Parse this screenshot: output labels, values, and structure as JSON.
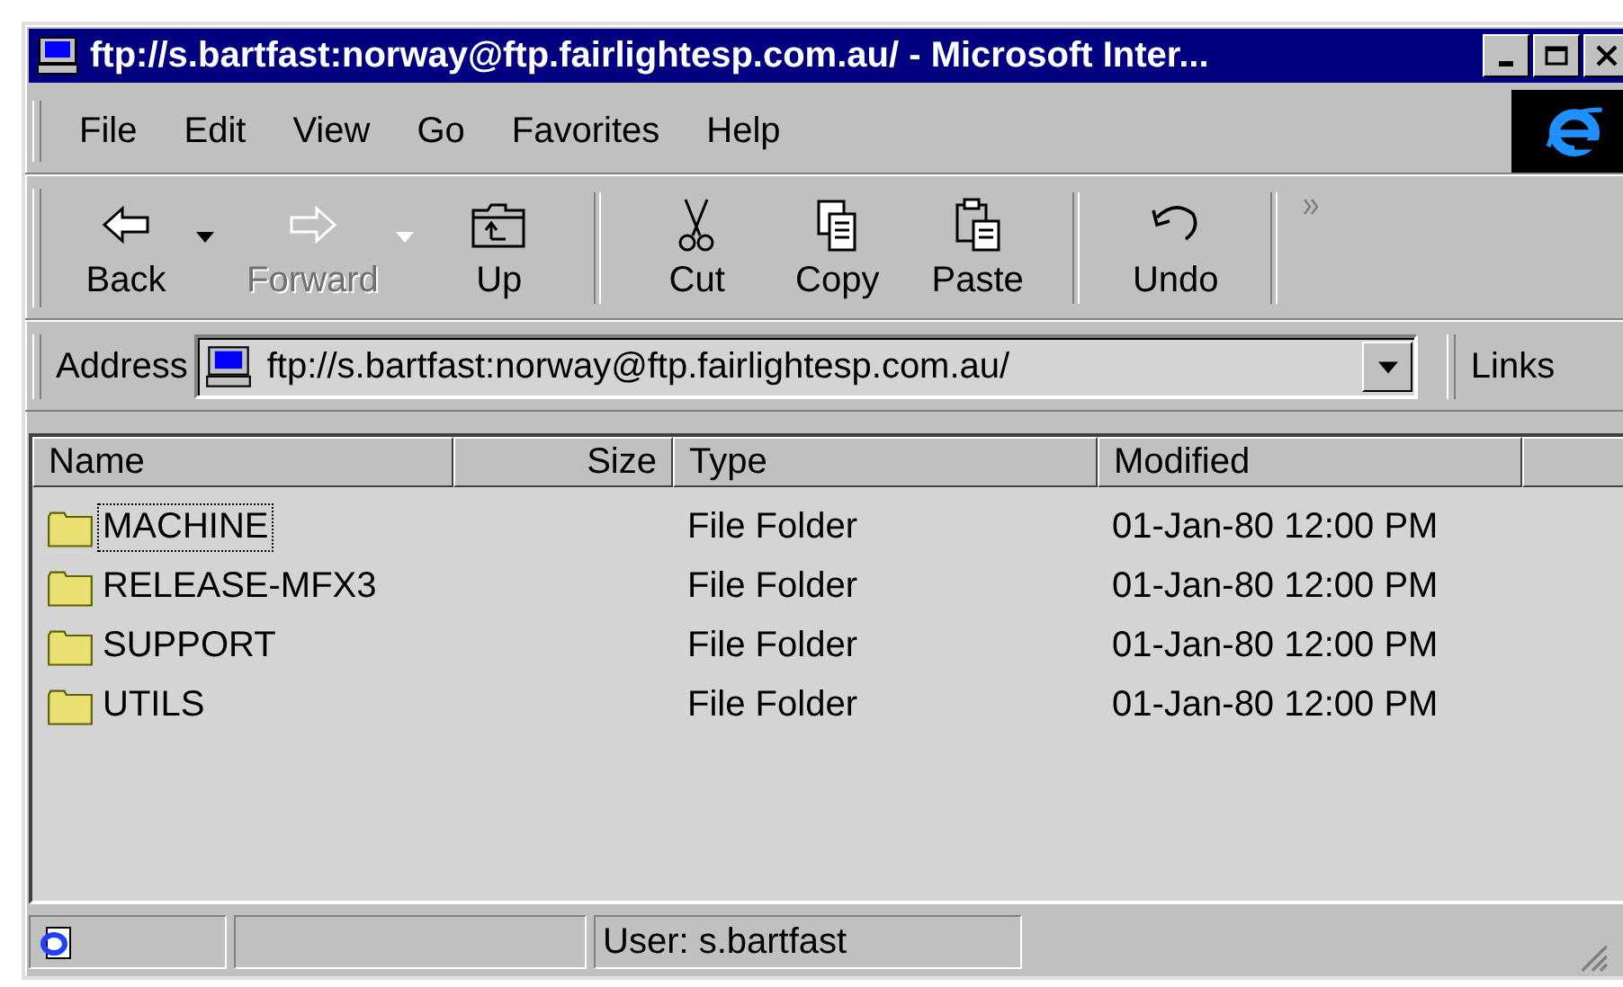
{
  "window": {
    "title": "ftp://s.bartfast:norway@ftp.fairlightesp.com.au/ - Microsoft Inter..."
  },
  "menu": [
    "File",
    "Edit",
    "View",
    "Go",
    "Favorites",
    "Help"
  ],
  "toolbar": [
    {
      "kind": "back",
      "label": "Back",
      "disabled": false,
      "dropdown": true
    },
    {
      "kind": "forward",
      "label": "Forward",
      "disabled": true,
      "dropdown": true
    },
    {
      "kind": "up",
      "label": "Up",
      "disabled": false,
      "dropdown": false
    },
    {
      "kind": "separator"
    },
    {
      "kind": "cut",
      "label": "Cut",
      "disabled": false,
      "dropdown": false
    },
    {
      "kind": "copy",
      "label": "Copy",
      "disabled": false,
      "dropdown": false
    },
    {
      "kind": "paste",
      "label": "Paste",
      "disabled": false,
      "dropdown": false
    },
    {
      "kind": "separator"
    },
    {
      "kind": "undo",
      "label": "Undo",
      "disabled": false,
      "dropdown": false
    }
  ],
  "address": {
    "label": "Address",
    "value": "ftp://s.bartfast:norway@ftp.fairlightesp.com.au/",
    "links": "Links"
  },
  "table": {
    "columns": [
      "Name",
      "Size",
      "Type",
      "Modified"
    ],
    "rows": [
      {
        "name": "MACHINE",
        "size": "",
        "type": "File Folder",
        "modified": "01-Jan-80 12:00 PM",
        "focused": true
      },
      {
        "name": "RELEASE-MFX3",
        "size": "",
        "type": "File Folder",
        "modified": "01-Jan-80 12:00 PM",
        "focused": false
      },
      {
        "name": "SUPPORT",
        "size": "",
        "type": "File Folder",
        "modified": "01-Jan-80 12:00 PM",
        "focused": false
      },
      {
        "name": "UTILS",
        "size": "",
        "type": "File Folder",
        "modified": "01-Jan-80 12:00 PM",
        "focused": false
      }
    ]
  },
  "status_bar": {
    "user": "User: s.bartfast"
  }
}
